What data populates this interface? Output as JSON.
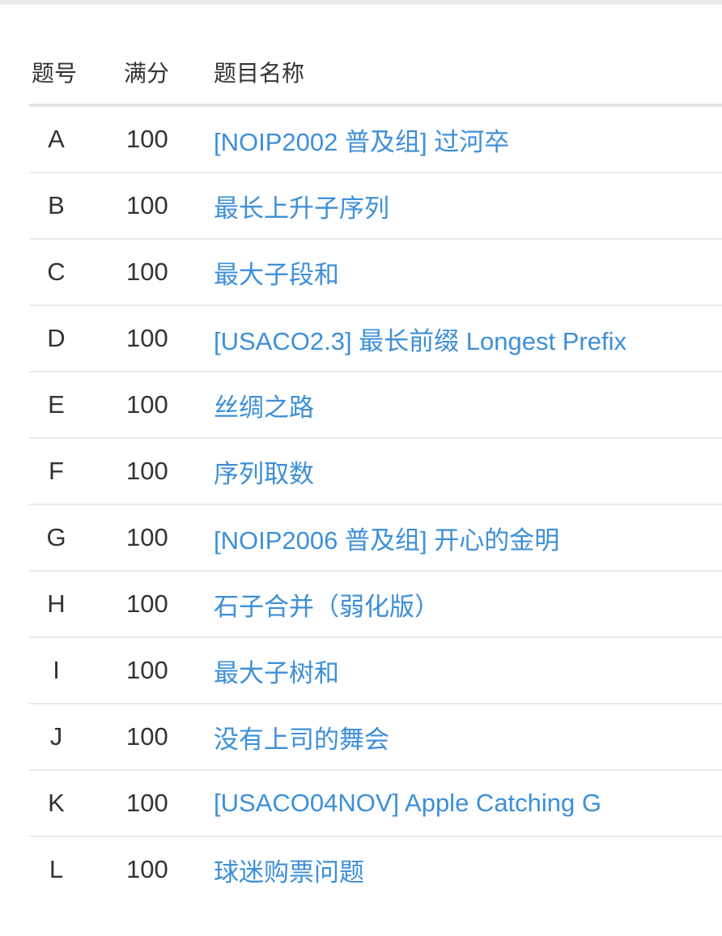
{
  "table": {
    "headers": {
      "id": "题号",
      "score": "满分",
      "name": "题目名称"
    },
    "rows": [
      {
        "id": "A",
        "score": "100",
        "name": "[NOIP2002 普及组] 过河卒"
      },
      {
        "id": "B",
        "score": "100",
        "name": "最长上升子序列"
      },
      {
        "id": "C",
        "score": "100",
        "name": "最大子段和"
      },
      {
        "id": "D",
        "score": "100",
        "name": "[USACO2.3] 最长前缀 Longest Prefix"
      },
      {
        "id": "E",
        "score": "100",
        "name": "丝绸之路"
      },
      {
        "id": "F",
        "score": "100",
        "name": "序列取数"
      },
      {
        "id": "G",
        "score": "100",
        "name": "[NOIP2006 普及组] 开心的金明"
      },
      {
        "id": "H",
        "score": "100",
        "name": "石子合并（弱化版）"
      },
      {
        "id": "I",
        "score": "100",
        "name": "最大子树和"
      },
      {
        "id": "J",
        "score": "100",
        "name": "没有上司的舞会"
      },
      {
        "id": "K",
        "score": "100",
        "name": "[USACO04NOV] Apple Catching G"
      },
      {
        "id": "L",
        "score": "100",
        "name": "球迷购票问题"
      }
    ]
  },
  "colors": {
    "link": "#3d8fd8",
    "text": "#333333",
    "divider": "#e9e9e9"
  }
}
